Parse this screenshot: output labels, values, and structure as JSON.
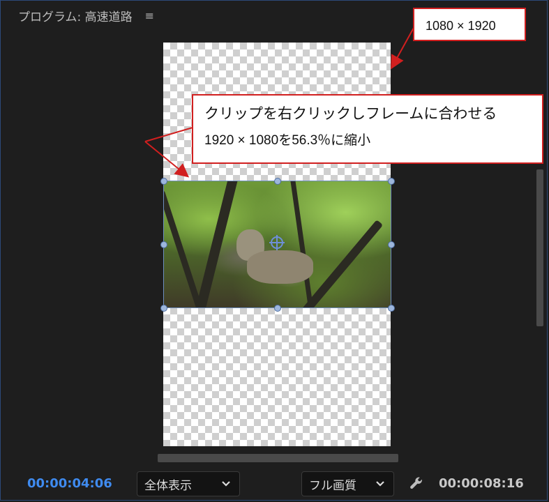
{
  "panel": {
    "title": "プログラム: 高速道路",
    "menu_icon": "hamburger-menu-icon"
  },
  "canvas": {
    "transparent_pattern": "checkerboard",
    "clip_description_icon": "anchor-point-icon"
  },
  "annotations": {
    "frame_size": "1080 × 1920",
    "note_line1": "クリップを右クリックしフレームに合わせる",
    "note_line2": "1920 × 1080を56.3％に縮小",
    "border_color": "#d11f1f"
  },
  "footer": {
    "current_time": "00:00:04:06",
    "zoom_select": "全体表示",
    "quality_select": "フル画質",
    "settings_icon": "wrench-icon",
    "duration": "00:00:08:16"
  },
  "colors": {
    "accent_blue": "#3f8bf0",
    "panel_bg": "#1e1e1e"
  }
}
